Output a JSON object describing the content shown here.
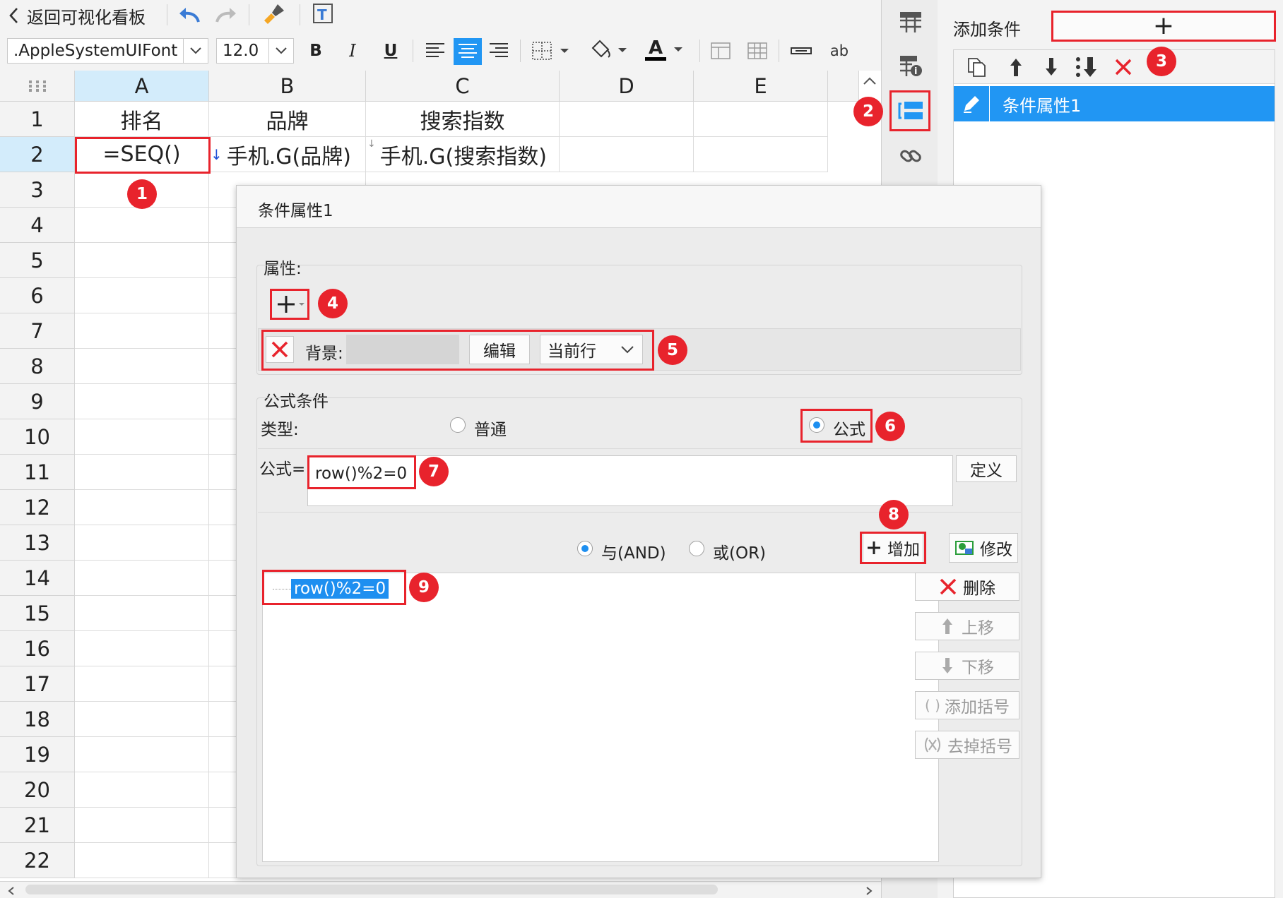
{
  "toolbar": {
    "back_label": "返回可视化看板",
    "font_name": ".AppleSystemUIFont",
    "font_size": "12.0",
    "bold": "B",
    "italic": "I",
    "underline": "U",
    "font_color_glyph": "A",
    "wrap_glyph": "ab"
  },
  "grid": {
    "columns": [
      "A",
      "B",
      "C",
      "D",
      "E"
    ],
    "rows": [
      "1",
      "2",
      "3",
      "4",
      "5",
      "6",
      "7",
      "8",
      "9",
      "10",
      "11",
      "12",
      "13",
      "14",
      "15",
      "16",
      "17",
      "18",
      "19",
      "20",
      "21",
      "22"
    ],
    "row1": [
      "排名",
      "品牌",
      "搜索指数",
      "",
      ""
    ],
    "row2": [
      "=SEQ()",
      "手机.G(品牌)",
      "手机.G(搜索指数)",
      "",
      ""
    ]
  },
  "dialog": {
    "title": "条件属性1",
    "attr_section": "属性:",
    "background_label": "背景:",
    "edit_button": "编辑",
    "scope_value": "当前行",
    "formula_section": "公式条件",
    "type_label": "类型:",
    "type_normal": "普通",
    "type_formula": "公式",
    "formula_label": "公式=",
    "formula_value": "row()%2=0",
    "define_button": "定义",
    "and_label": "与(AND)",
    "or_label": "或(OR)",
    "add_button": "增加",
    "modify_button": "修改",
    "delete_button": "删除",
    "up_button": "上移",
    "down_button": "下移",
    "add_paren_button": "添加括号",
    "remove_paren_button": "去掉括号",
    "conditions": [
      "row()%2=0"
    ]
  },
  "right_panel": {
    "title": "添加条件",
    "add_glyph": "+",
    "items": [
      "条件属性1"
    ]
  },
  "badges": [
    "1",
    "2",
    "3",
    "4",
    "5",
    "6",
    "7",
    "8",
    "9"
  ],
  "colors": {
    "accent": "#1e8ff0",
    "highlight": "#e8232c",
    "selected_row": "#2196f3"
  }
}
